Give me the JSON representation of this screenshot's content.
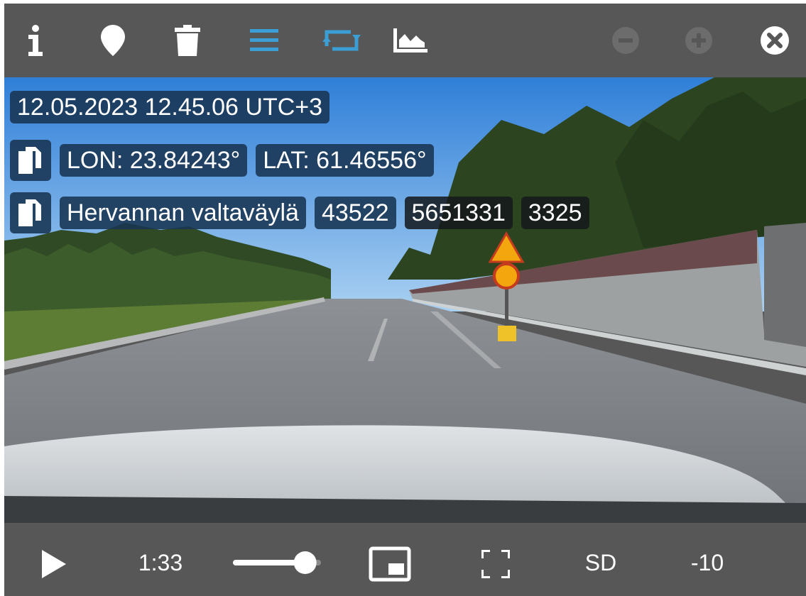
{
  "toolbar": {
    "left_icons": [
      "info-icon",
      "map-marker-icon",
      "trash-icon",
      "menu-icon",
      "repeat-icon",
      "area-chart-icon"
    ],
    "right_icons": [
      "zoom-out-icon",
      "zoom-in-icon",
      "close-icon"
    ],
    "active_color": "#3b9fd6",
    "disabled_color": "#6c6c6c"
  },
  "overlay": {
    "timestamp": "12.05.2023 12.45.06 UTC+3",
    "lon": "LON: 23.84243°",
    "lat": "LAT: 61.46556°",
    "road_name": "Hervannan valtaväylä",
    "road_number": "43522",
    "road_part": "5651331",
    "distance": "3325",
    "copy_icon": "copy-icon"
  },
  "controls": {
    "play_icon": "play-icon",
    "time": "1:33",
    "volume_level": 0.82,
    "pip_icon": "picture-in-picture-icon",
    "fullscreen_icon": "fullscreen-icon",
    "quality": "SD",
    "skip": "-10"
  }
}
